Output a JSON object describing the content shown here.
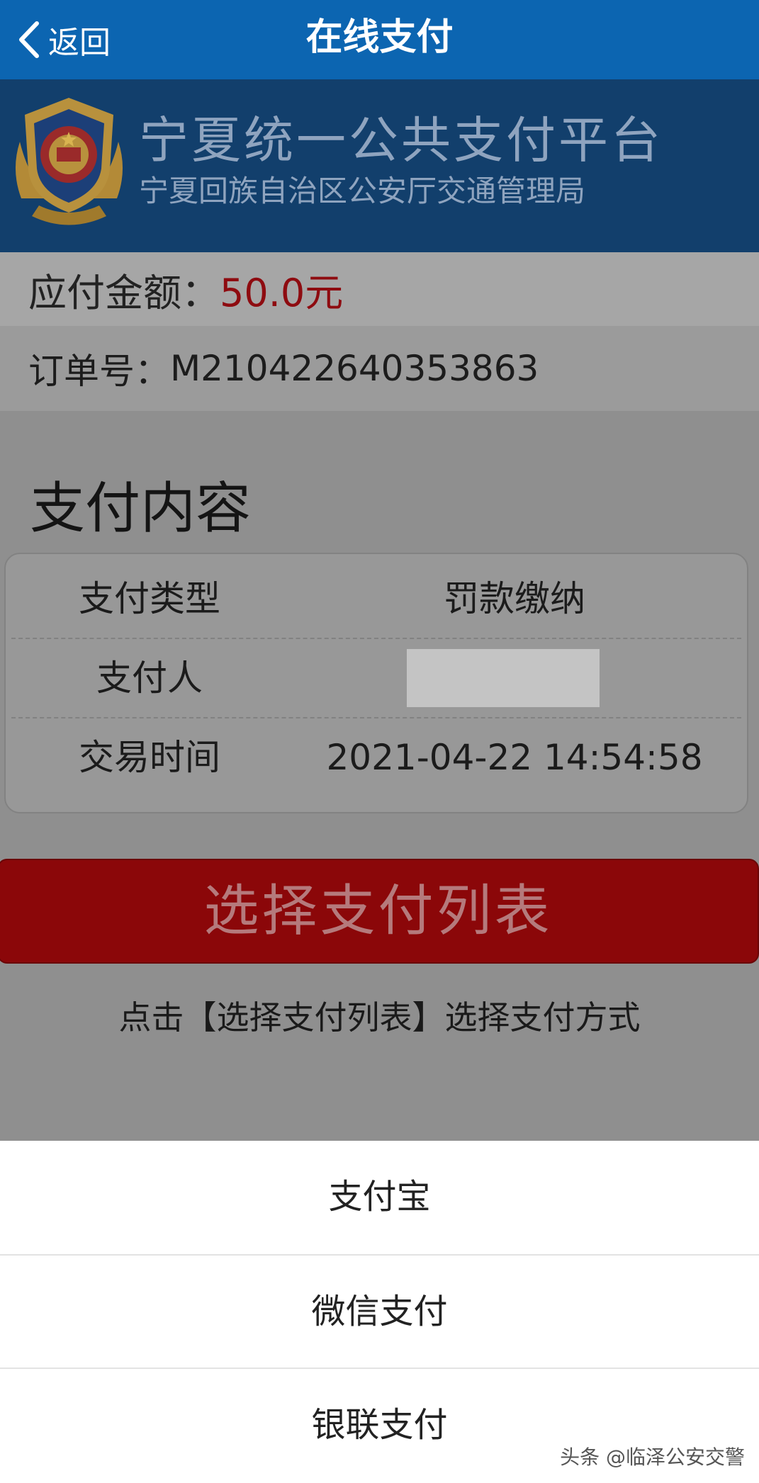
{
  "nav": {
    "back_label": "返回",
    "title": "在线支付"
  },
  "banner": {
    "title": "宁夏统一公共支付平台",
    "subtitle": "宁夏回族自治区公安厅交通管理局"
  },
  "amount": {
    "label": "应付金额：",
    "value": "50.0元"
  },
  "order": {
    "label": "订单号：",
    "value": "M210422640353863"
  },
  "content": {
    "title": "支付内容",
    "rows": [
      {
        "label": "支付类型",
        "value": "罚款缴纳"
      },
      {
        "label": "支付人",
        "value": ""
      },
      {
        "label": "交易时间",
        "value": "2021-04-22 14:54:58"
      }
    ]
  },
  "pay_list_button": "选择支付列表",
  "hint": "点击【选择支付列表】选择支付方式",
  "payment_options": [
    "支付宝",
    "微信支付",
    "银联支付"
  ],
  "watermark": "头条 @临泽公安交警",
  "colors": {
    "nav_bg": "#0c65b1",
    "banner_bg": "#123f6c",
    "amount": "#8e0b10",
    "button_bg": "#8b0709"
  }
}
